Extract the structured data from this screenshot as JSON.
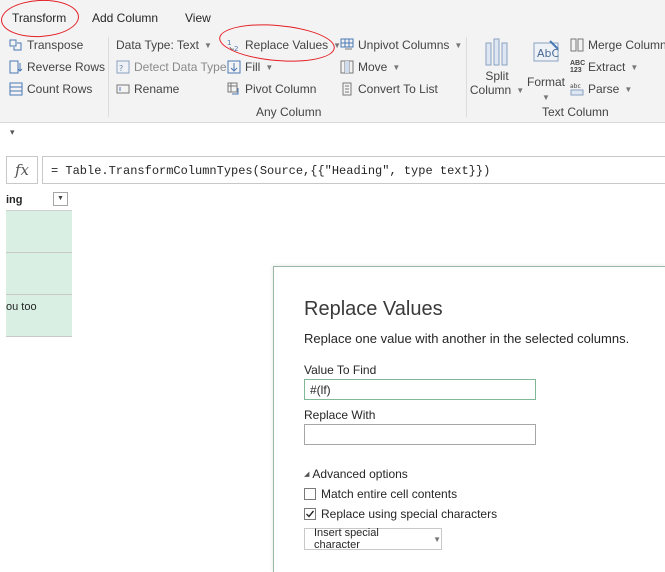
{
  "tabs": [
    {
      "label": "Transform",
      "active": true
    },
    {
      "label": "Add Column",
      "active": false
    },
    {
      "label": "View",
      "active": false
    }
  ],
  "ribbon": {
    "col1": [
      "Transpose",
      "Reverse Rows",
      "Count Rows"
    ],
    "data_type": "Data Type: Text",
    "detect_data_type": "Detect Data Type",
    "rename": "Rename",
    "replace_values": "Replace Values",
    "fill": "Fill",
    "pivot_column": "Pivot Column",
    "unpivot_columns": "Unpivot Columns",
    "move": "Move",
    "convert_to_list": "Convert To List",
    "any_column_label": "Any Column",
    "split_column": [
      "Split",
      "Column"
    ],
    "format": "Format",
    "merge_columns": "Merge Column",
    "extract": "Extract",
    "parse": "Parse",
    "text_column_label": "Text Column"
  },
  "formula": "= Table.TransformColumnTypes(Source,{{\"Heading\", type text}})",
  "fx_label": "fx",
  "grid": {
    "header": "ing",
    "rows": [
      "",
      "",
      "ou too"
    ]
  },
  "dialog": {
    "title": "Replace Values",
    "description": "Replace one value with another in the selected columns.",
    "value_to_find_label": "Value To Find",
    "value_to_find": "#(lf)",
    "replace_with_label": "Replace With",
    "replace_with": "",
    "advanced_options": "Advanced options",
    "match_entire_cell": {
      "label": "Match entire cell contents",
      "checked": false
    },
    "replace_special": {
      "label": "Replace using special characters",
      "checked": true
    },
    "insert_special_character": "Insert special character"
  },
  "colors": {
    "annotation": "#e31e24",
    "cell_highlight": "#d9efe3",
    "accent": "#217346"
  }
}
